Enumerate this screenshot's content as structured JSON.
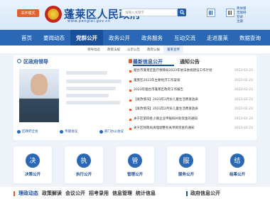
{
  "header": {
    "care_mode_label": "关怀模式",
    "emblem_char": "徽",
    "site_name": "蓬莱区人民政府",
    "domain": "www.penglai.gov.cn",
    "search_placeholder": "请输入关键字",
    "top_links": [
      "简体版",
      "无障碍",
      "登录",
      "注册"
    ]
  },
  "nav": {
    "items": [
      "首页",
      "要闻动态",
      "党群公开",
      "政务公开",
      "政务服务",
      "互动交流",
      "走进蓬莱",
      "数据查询"
    ],
    "active_index": 2
  },
  "subnav": {
    "items": [
      "领导动态",
      "政策法规",
      "公示公告",
      "政府公报",
      "蓬莱宣传"
    ],
    "active_index": 4
  },
  "leader": {
    "title": "区政府领导",
    "buttons": [
      "区政府全会",
      "专题会议",
      "部门办公会议"
    ]
  },
  "news": {
    "tab_active": "最新信息公开",
    "tab_other": "通知公告",
    "items": [
      {
        "title": "烟台市蓬莱区医疗保障局2023年依法依规建设工作计划",
        "date": "2023-02-23"
      },
      {
        "title": "蓬莱区2023年主要经济工作安排",
        "date": "2023-02-23"
      },
      {
        "title": "2023年烟台市蓬莱区政府工作报告",
        "date": "2023-02-23"
      },
      {
        "title": "【发改情况】2023年2月份儿童生活费发放表",
        "date": "2023-02-23"
      },
      {
        "title": "【发改情况】2023年2月份儿童生活费发放表",
        "date": "2023-02-23"
      },
      {
        "title": "关于区第四批小微企业申报拟补助资金的通知",
        "date": "2023-02-23"
      },
      {
        "title": "关于区财政局清理调整有关项目资金的通知",
        "date": "2023-02-23"
      }
    ]
  },
  "services": [
    {
      "label": "决策公开",
      "icon": "决"
    },
    {
      "label": "执行公开",
      "icon": "执"
    },
    {
      "label": "管理公开",
      "icon": "管"
    },
    {
      "label": "服务公开",
      "icon": "服"
    },
    {
      "label": "结果公开",
      "icon": "结"
    }
  ],
  "bottom": {
    "left_items": [
      "理政动态",
      "政策解读",
      "会议公开",
      "招考录用",
      "信息管理",
      "统计信息"
    ],
    "right_title": "政府信息公开"
  },
  "colors": {
    "primary": "#2a68b5",
    "dark": "#1a4f9c",
    "accent": "#e55a2b"
  }
}
